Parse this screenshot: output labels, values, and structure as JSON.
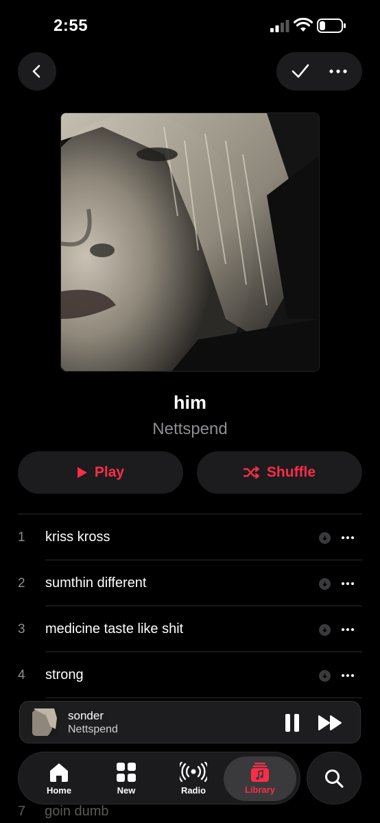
{
  "status_bar": {
    "time": "2:55"
  },
  "album": {
    "title": "him",
    "artist": "Nettspend",
    "artwork_icon": "album-cover-portrait"
  },
  "actions": {
    "play_label": "Play",
    "shuffle_label": "Shuffle",
    "accent_color": "#fa2d48"
  },
  "tracks": [
    {
      "number": "1",
      "title": "kriss kross"
    },
    {
      "number": "2",
      "title": "sumthin different"
    },
    {
      "number": "3",
      "title": "medicine taste like shit"
    },
    {
      "number": "4",
      "title": "strong"
    }
  ],
  "partially_hidden_track": {
    "number": "7",
    "title": "goin dumb"
  },
  "now_playing": {
    "title": "sonder",
    "artist": "Nettspend"
  },
  "tab_bar": {
    "home": "Home",
    "new": "New",
    "radio": "Radio",
    "library": "Library",
    "active": "Library"
  }
}
